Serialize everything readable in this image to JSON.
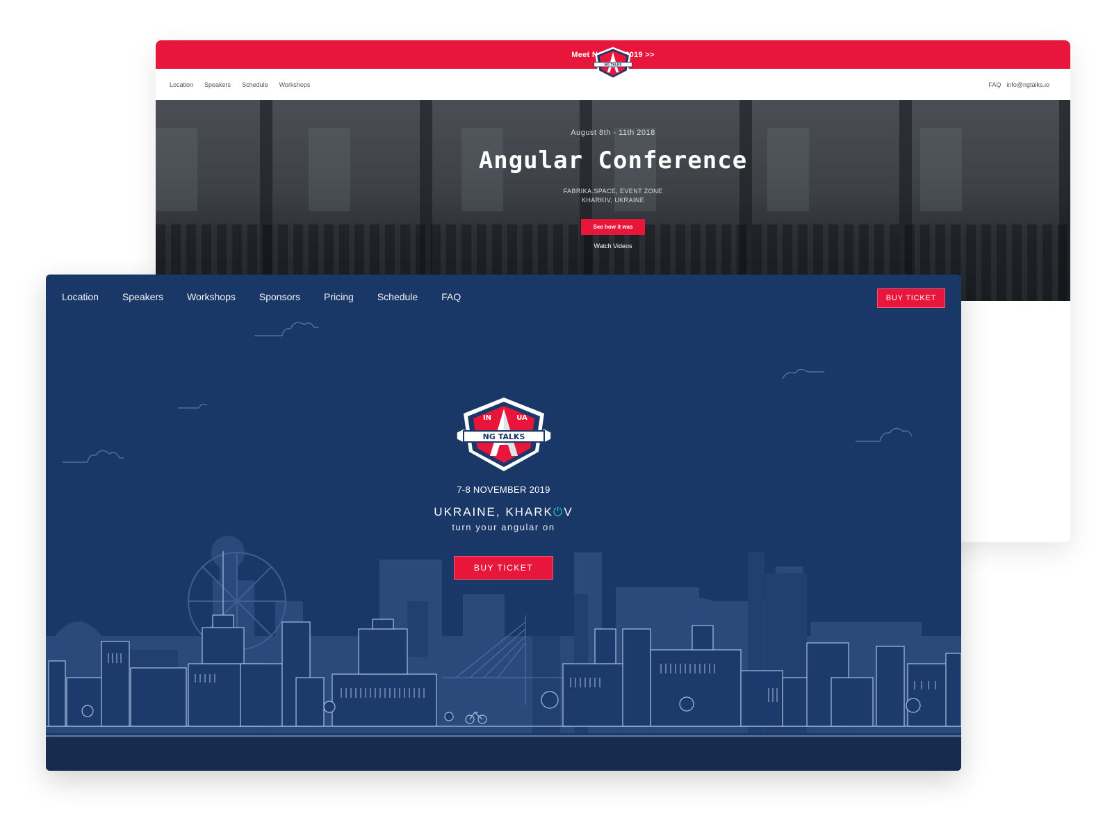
{
  "old_site": {
    "promo_banner": "Meet NgTalks 2019 >>",
    "nav_left": [
      "Location",
      "Speakers",
      "Schedule",
      "Workshops"
    ],
    "nav_right": [
      "FAQ",
      "info@ngtalks.io"
    ],
    "hero": {
      "dates": "August 8th - 11th 2018",
      "title": "Angular Conference",
      "venue_line1": "FABRIKA.SPACE, EVENT ZONE",
      "venue_line2": "KHARKIV, UKRAINE",
      "cta": "See how it was",
      "secondary_link": "Watch Videos"
    }
  },
  "new_site": {
    "nav": [
      "Location",
      "Speakers",
      "Workshops",
      "Sponsors",
      "Pricing",
      "Schedule",
      "FAQ"
    ],
    "buy_ticket_top": "BUY TICKET",
    "logo": {
      "left_text": "IN",
      "right_text": "UA",
      "banner_text": "NG TALKS"
    },
    "date": "7-8 NOVEMBER 2019",
    "city_prefix": "UKRAINE, KHARK",
    "city_power_glyph": "⏻",
    "city_suffix": "V",
    "tagline": "turn your angular on",
    "buy_ticket_main": "BUY TICKET"
  },
  "colors": {
    "brand_red": "#e9163c",
    "navy": "#1a3867",
    "accent_teal": "#27c4b0"
  }
}
